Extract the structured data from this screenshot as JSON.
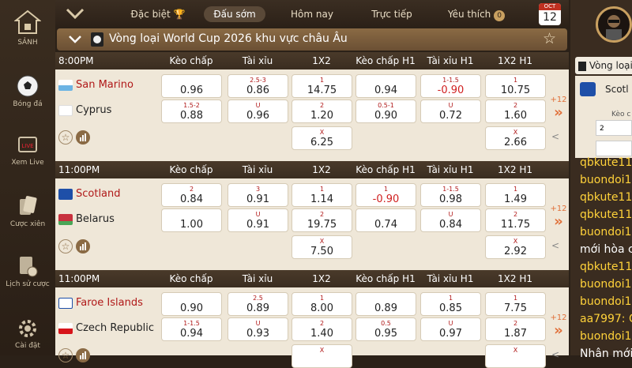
{
  "sidebar": {
    "items": [
      {
        "label": "SẢNH"
      },
      {
        "label": "Bóng đá"
      },
      {
        "label": "Xem Live"
      },
      {
        "label": "Cược xiên"
      },
      {
        "label": "Lịch sử cược"
      },
      {
        "label": "Cài đặt"
      }
    ]
  },
  "tabs": [
    {
      "label": "Đặc biệt"
    },
    {
      "label": "Đấu sớm"
    },
    {
      "label": "Hôm nay"
    },
    {
      "label": "Trực tiếp"
    },
    {
      "label": "Yêu thích",
      "badge": "0"
    }
  ],
  "calendar": {
    "month": "OCT",
    "day": "12"
  },
  "league": {
    "name": "Vòng loại World Cup 2026 khu vực châu Âu"
  },
  "columns": [
    "Kèo chấp",
    "Tài xỉu",
    "1X2",
    "Kèo chấp H1",
    "Tài xỉu H1",
    "1X2 H1"
  ],
  "matches": [
    {
      "time": "8:00PM",
      "home": "San Marino",
      "away": "Cyprus",
      "more": "+12",
      "home_odds": [
        [
          "",
          "0.96"
        ],
        [
          "2.5-3",
          "0.86"
        ],
        [
          "1",
          "14.75"
        ],
        [
          "",
          "0.94"
        ],
        [
          "1-1.5",
          "-0.90"
        ],
        [
          "1",
          "10.75"
        ]
      ],
      "away_odds": [
        [
          "1.5-2",
          "0.88"
        ],
        [
          "U",
          "0.96"
        ],
        [
          "2",
          "1.20"
        ],
        [
          "0.5-1",
          "0.90"
        ],
        [
          "U",
          "0.72"
        ],
        [
          "2",
          "1.60"
        ]
      ],
      "draw": [
        "X",
        "6.25"
      ],
      "draw_h1": [
        "X",
        "2.66"
      ]
    },
    {
      "time": "11:00PM",
      "home": "Scotland",
      "away": "Belarus",
      "more": "+12",
      "home_odds": [
        [
          "2",
          "0.84"
        ],
        [
          "3",
          "0.91"
        ],
        [
          "1",
          "1.14"
        ],
        [
          "1",
          "-0.90"
        ],
        [
          "1-1.5",
          "0.98"
        ],
        [
          "1",
          "1.49"
        ]
      ],
      "away_odds": [
        [
          "",
          "1.00"
        ],
        [
          "U",
          "0.91"
        ],
        [
          "2",
          "19.75"
        ],
        [
          "",
          "0.74"
        ],
        [
          "U",
          "0.84"
        ],
        [
          "2",
          "11.75"
        ]
      ],
      "draw": [
        "X",
        "7.50"
      ],
      "draw_h1": [
        "X",
        "2.92"
      ]
    },
    {
      "time": "11:00PM",
      "home": "Faroe Islands",
      "away": "Czech Republic",
      "more": "+12",
      "home_odds": [
        [
          "",
          "0.90"
        ],
        [
          "2.5",
          "0.89"
        ],
        [
          "1",
          "8.00"
        ],
        [
          "",
          "0.89"
        ],
        [
          "1",
          "0.85"
        ],
        [
          "1",
          "7.75"
        ]
      ],
      "away_odds": [
        [
          "1-1.5",
          "0.94"
        ],
        [
          "U",
          "0.93"
        ],
        [
          "2",
          "1.40"
        ],
        [
          "0.5",
          "0.95"
        ],
        [
          "U",
          "0.97"
        ],
        [
          "2",
          "1.87"
        ]
      ],
      "draw": [
        "X",
        ""
      ],
      "draw_h1": [
        "X",
        ""
      ]
    }
  ],
  "chat": {
    "header": "Vòng loại",
    "match_team": "Scotl",
    "input_label": "Kèo c",
    "input_value": "2",
    "lines": [
      "qbkute11",
      "buondoi1",
      "qbkute11",
      "qbkute11",
      "buondoi1",
      "mới hòa c",
      "qbkute11",
      "buondoi1",
      "buondoi1",
      "aa7997: C",
      "buondoi1",
      "Nhân mới"
    ]
  }
}
